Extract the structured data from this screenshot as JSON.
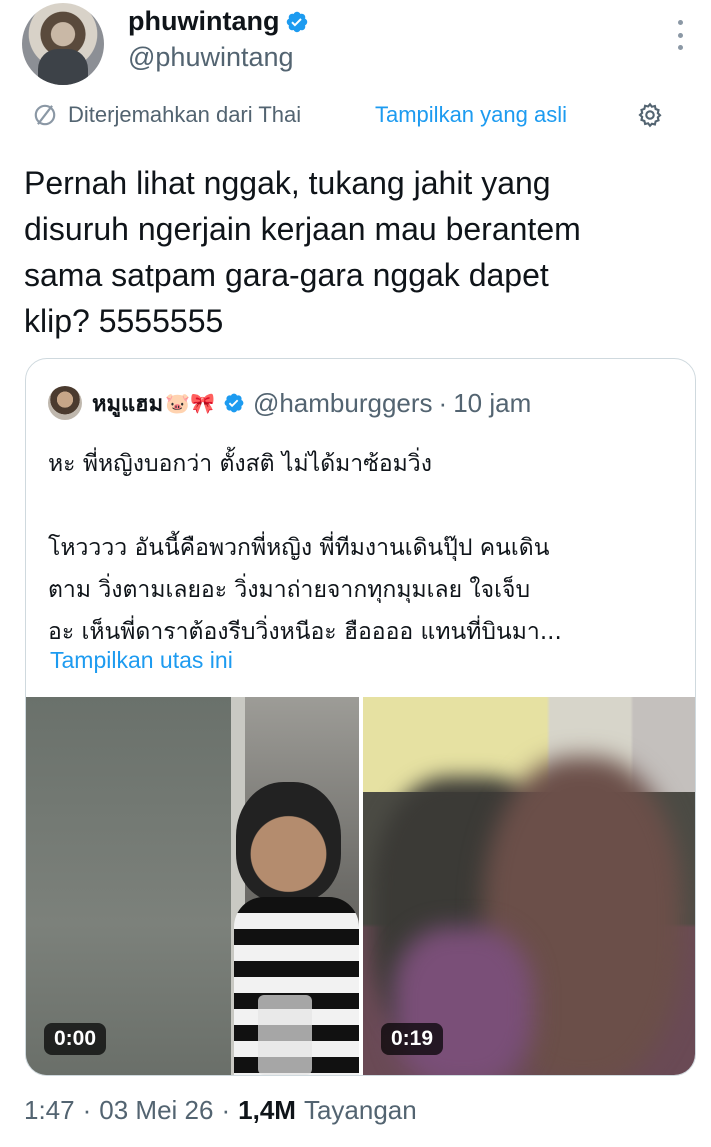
{
  "author": {
    "display_name": "phuwintang",
    "handle": "@phuwintang",
    "verified": true
  },
  "translation": {
    "translated_from": "Diterjemahkan dari Thai",
    "show_original": "Tampilkan yang asli"
  },
  "tweet": {
    "text": "Pernah lihat nggak, tukang jahit yang\ndisuruh ngerjain kerjaan mau berantem\nsama satpam gara-gara nggak dapet\nklip? 5555555"
  },
  "quote": {
    "display_name": "หมูแฮม",
    "emoji": "🐷🎀",
    "verified": true,
    "handle": "@hamburggers",
    "separator": "·",
    "time": "10 jam",
    "text": "หะ พี่หญิงบอกว่า ตั้งสติ ไม่ได้มาซ้อมวิ่ง\n\nโหวววว อันนี้คือพวกพี่หญิง พี่ทีมงานเดินปุ๊ป คนเดิน\nตาม วิ่งตามเลยอะ วิ่งมาถ่ายจากทุกมุมเลย ใจเจ็บ\nอะ เห็นพี่ดาราต้องรีบวิ่งหนีอะ ฮืออออ แทนที่บินมา...",
    "show_thread": "Tampilkan utas ini",
    "media": [
      {
        "duration": "0:00"
      },
      {
        "duration": "0:19"
      }
    ]
  },
  "footer": {
    "time": "1:47",
    "separator": "·",
    "date": "03 Mei 26",
    "views_count": "1,4M",
    "views_label": "Tayangan"
  },
  "colors": {
    "accent": "#1d9bf0",
    "secondary_text": "#536471",
    "primary_text": "#0f1419",
    "border": "#cfd9de"
  }
}
